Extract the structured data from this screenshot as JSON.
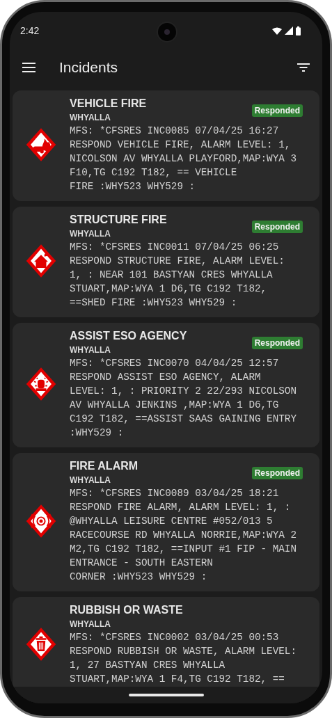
{
  "status_bar": {
    "time": "2:42"
  },
  "app_bar": {
    "title": "Incidents"
  },
  "incidents": [
    {
      "kind": "vehicle",
      "title": "VEHICLE FIRE",
      "location": "WHYALLA",
      "badge": "Responded",
      "description": "MFS: *CFSRES INC0085 07/04/25 16:27\nRESPOND VEHICLE FIRE, ALARM LEVEL: 1,\nNICOLSON AV WHYALLA PLAYFORD,MAP:WYA 3\nF10,TG C192 T182, == VEHICLE\nFIRE :WHY523 WHY529 :"
    },
    {
      "kind": "structure",
      "title": "STRUCTURE FIRE",
      "location": "WHYALLA",
      "badge": "Responded",
      "description": "MFS: *CFSRES INC0011 07/04/25 06:25\nRESPOND STRUCTURE FIRE, ALARM LEVEL:\n1, : NEAR 101 BASTYAN CRES WHYALLA\nSTUART,MAP:WYA 1 D6,TG C192 T182,\n==SHED FIRE :WHY523 WHY529 :"
    },
    {
      "kind": "agency",
      "title": "ASSIST ESO AGENCY",
      "location": "WHYALLA",
      "badge": "Responded",
      "description": "MFS: *CFSRES INC0070 04/04/25 12:57\nRESPOND ASSIST ESO AGENCY, ALARM\nLEVEL: 1, : PRIORITY 2 22/293 NICOLSON\nAV WHYALLA JENKINS ,MAP:WYA 1 D6,TG\nC192 T182, ==ASSIST SAAS GAINING ENTRY\n:WHY529 :"
    },
    {
      "kind": "alarm",
      "title": "FIRE ALARM",
      "location": "WHYALLA",
      "badge": "Responded",
      "description": "MFS: *CFSRES INC0089 03/04/25 18:21\nRESPOND FIRE ALARM, ALARM LEVEL: 1, :\n@WHYALLA LEISURE CENTRE #052/013 5\nRACECOURSE RD WHYALLA NORRIE,MAP:WYA 2\nM2,TG C192 T182, ==INPUT #1 FIP - MAIN\nENTRANCE - SOUTH EASTERN\nCORNER :WHY523 WHY529 :"
    },
    {
      "kind": "rubbish",
      "title": "RUBBISH OR WASTE",
      "location": "WHYALLA",
      "description": "MFS: *CFSRES INC0002 03/04/25 00:53\nRESPOND RUBBISH OR WASTE, ALARM LEVEL:\n1, 27 BASTYAN CRES WHYALLA\nSTUART,MAP:WYA 1 F4,TG C192 T182, =="
    }
  ]
}
